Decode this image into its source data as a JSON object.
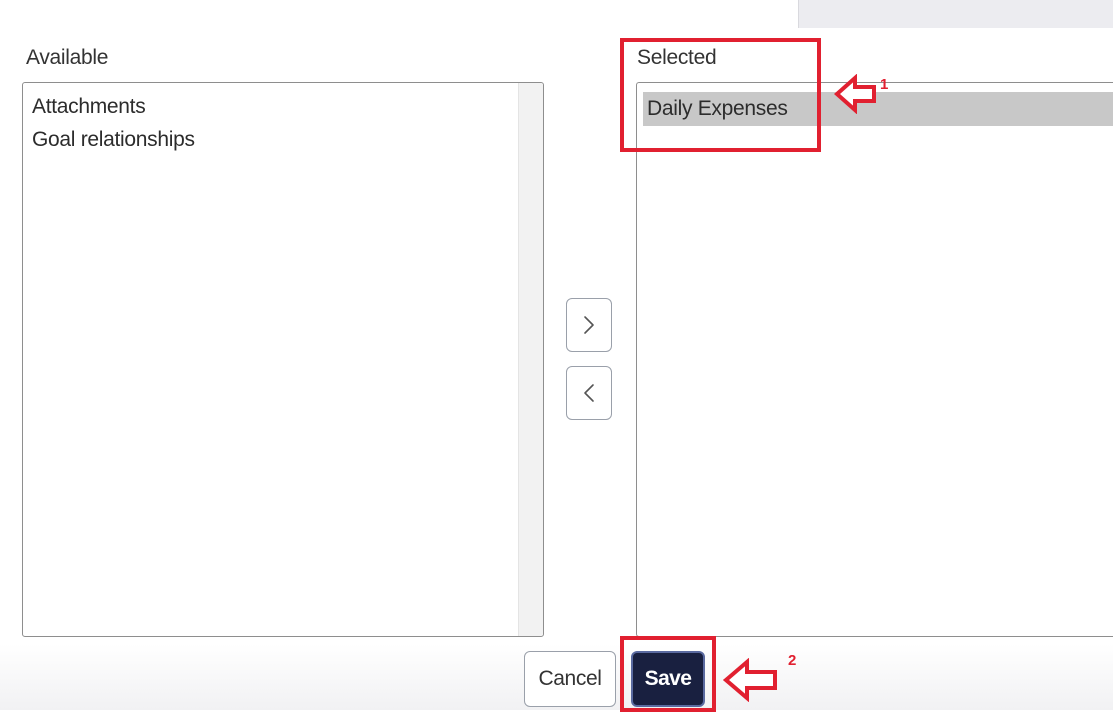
{
  "available": {
    "label": "Available",
    "items": [
      "Attachments",
      "Goal relationships"
    ]
  },
  "selected": {
    "label": "Selected",
    "items": [
      "Daily Expenses"
    ]
  },
  "move_buttons": {
    "add_icon": "chevron-right-icon",
    "remove_icon": "chevron-left-icon"
  },
  "footer": {
    "cancel_label": "Cancel",
    "save_label": "Save"
  },
  "annotations": {
    "callout_1": "1",
    "callout_2": "2",
    "highlight_color": "#e12030"
  },
  "colors": {
    "save_bg": "#192040",
    "selected_row_bg": "#c8c8c8"
  }
}
